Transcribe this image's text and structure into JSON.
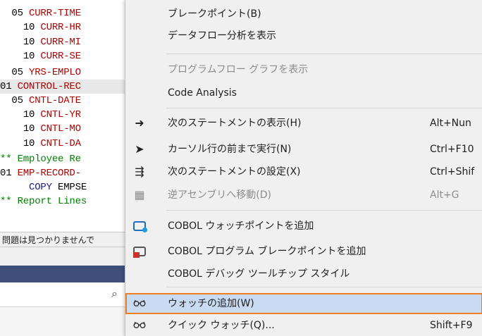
{
  "editor": {
    "lines": [
      {
        "indent": "  ",
        "num": "05",
        "name": "CURR-TIME",
        "style": "red"
      },
      {
        "indent": "    ",
        "num": "10",
        "name": "CURR-HR",
        "style": "red"
      },
      {
        "indent": "    ",
        "num": "10",
        "name": "CURR-MI",
        "style": "red"
      },
      {
        "indent": "    ",
        "num": "10",
        "name": "CURR-SE",
        "style": "red"
      },
      {
        "indent": "  ",
        "num": "05",
        "name": "YRS-EMPLO",
        "style": "red"
      },
      {
        "indent": "",
        "num": "01",
        "name": "CONTROL-REC",
        "style": "red"
      },
      {
        "indent": "  ",
        "num": "05",
        "name": "CNTL-DATE",
        "style": "red"
      },
      {
        "indent": "    ",
        "num": "10",
        "name": "CNTL-YR",
        "style": "red"
      },
      {
        "indent": "    ",
        "num": "10",
        "name": "CNTL-MO",
        "style": "red"
      },
      {
        "indent": "    ",
        "num": "10",
        "name": "CNTL-DA",
        "style": "red"
      },
      {
        "indent": "",
        "num": "**",
        "name": "Employee Re",
        "style": "green"
      },
      {
        "indent": "",
        "num": "01",
        "name": "EMP-RECORD-",
        "style": "red"
      },
      {
        "indent": "     ",
        "num": "COPY",
        "name": "EMPSE",
        "style": "copy"
      },
      {
        "indent": "",
        "num": "**",
        "name": "Report Lines",
        "style": "green"
      }
    ],
    "status_text": "問題は見つかりませんで"
  },
  "context_menu": {
    "items": [
      {
        "label": "ブレークポイント(B)",
        "shortcut": "",
        "icon": "",
        "disabled": false
      },
      {
        "label": "データフロー分析を表示",
        "shortcut": "",
        "icon": "",
        "disabled": false
      },
      {
        "label": "プログラムフロー グラフを表示",
        "shortcut": "",
        "icon": "",
        "disabled": true
      },
      {
        "label": "Code Analysis",
        "shortcut": "",
        "icon": "",
        "disabled": false
      },
      {
        "label": "次のステートメントの表示(H)",
        "shortcut": "Alt+Nun",
        "icon": "arrow-right-icon",
        "disabled": false
      },
      {
        "label": "カーソル行の前まで実行(N)",
        "shortcut": "Ctrl+F10",
        "icon": "cursor-icon",
        "disabled": false
      },
      {
        "label": "次のステートメントの設定(X)",
        "shortcut": "Ctrl+Shif",
        "icon": "set-next-statement-icon",
        "disabled": false
      },
      {
        "label": "逆アセンブリへ移動(D)",
        "shortcut": "Alt+G",
        "icon": "disassembly-icon",
        "disabled": true
      },
      {
        "label": "COBOL ウォッチポイントを追加",
        "shortcut": "",
        "icon": "cobol-watchpoint-icon",
        "disabled": false
      },
      {
        "label": "COBOL プログラム ブレークポイントを追加",
        "shortcut": "",
        "icon": "cobol-breakpoint-icon",
        "disabled": false
      },
      {
        "label": "COBOL デバッグ ツールチップ スタイル",
        "shortcut": "",
        "icon": "",
        "disabled": false
      },
      {
        "label": "ウォッチの追加(W)",
        "shortcut": "",
        "icon": "glasses-icon",
        "disabled": false,
        "highlighted": true
      },
      {
        "label": "クイック ウォッチ(Q)...",
        "shortcut": "Shift+F9",
        "icon": "glasses-icon",
        "disabled": false
      }
    ]
  },
  "colors": {
    "highlight_bg": "#c9dbf3",
    "highlight_border": "#f07f21",
    "code_red": "#b00000",
    "code_green": "#008000"
  }
}
